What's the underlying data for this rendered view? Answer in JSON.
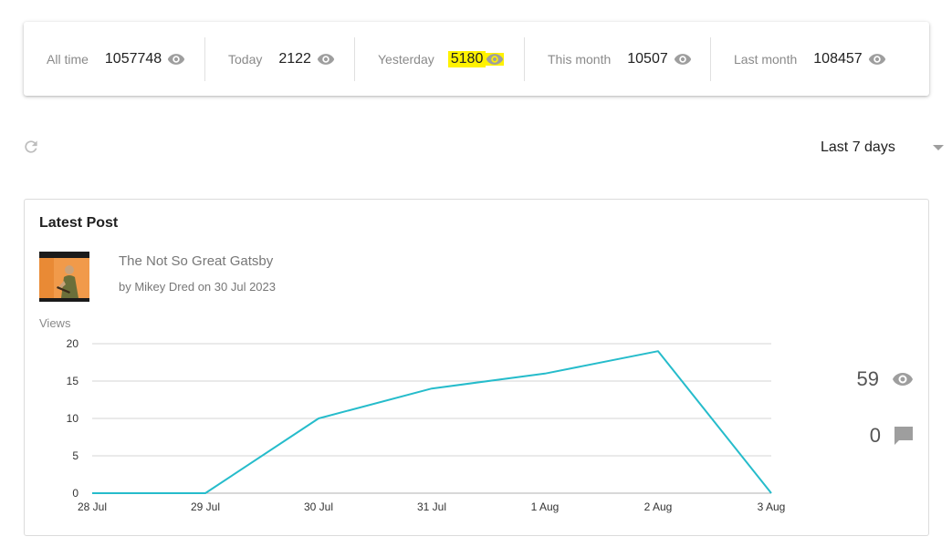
{
  "stats": [
    {
      "label": "All time",
      "value": "1057748",
      "highlight": false
    },
    {
      "label": "Today",
      "value": "2122",
      "highlight": false
    },
    {
      "label": "Yesterday",
      "value": "5180",
      "highlight": true
    },
    {
      "label": "This month",
      "value": "10507",
      "highlight": false
    },
    {
      "label": "Last month",
      "value": "108457",
      "highlight": false
    }
  ],
  "range": {
    "selected": "Last 7 days"
  },
  "post": {
    "heading": "Latest Post",
    "title": "The Not So Great Gatsby",
    "meta": "by Mikey Dred on 30 Jul 2023",
    "views_total": "59",
    "comments_total": "0"
  },
  "colors": {
    "line": "#26bccb",
    "grid": "#d6d6d6",
    "icon": "#9e9e9e",
    "highlight": "#fff200"
  },
  "icons": {
    "views": "eye-icon",
    "comments": "comment-icon",
    "refresh": "refresh-icon",
    "dropdown": "caret-down-icon"
  },
  "chart_data": {
    "type": "line",
    "ylabel": "Views",
    "xlabel": "",
    "categories": [
      "28 Jul",
      "29 Jul",
      "30 Jul",
      "31 Jul",
      "1 Aug",
      "2 Aug",
      "3 Aug"
    ],
    "values": [
      0,
      0,
      10,
      14,
      16,
      19,
      0
    ],
    "ylim": [
      0,
      20
    ],
    "yticks": [
      0,
      5,
      10,
      15,
      20
    ],
    "grid": true
  }
}
